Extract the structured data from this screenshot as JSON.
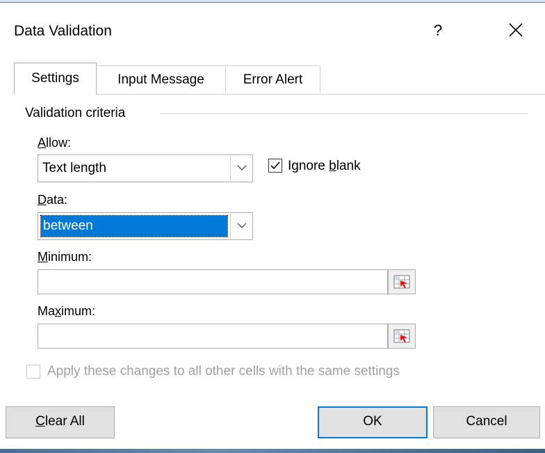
{
  "dialog": {
    "title": "Data Validation",
    "help_label": "?"
  },
  "tabs": [
    {
      "label": "Settings",
      "active": true
    },
    {
      "label": "Input Message",
      "active": false
    },
    {
      "label": "Error Alert",
      "active": false
    }
  ],
  "criteria": {
    "group_label": "Validation criteria",
    "allow": {
      "label_prefix": "",
      "label_mnemonic": "A",
      "label_suffix": "llow:",
      "value": "Text length"
    },
    "ignore_blank": {
      "label_prefix": "Ignore ",
      "label_mnemonic": "b",
      "label_suffix": "lank",
      "checked": true
    },
    "data": {
      "label_prefix": "",
      "label_mnemonic": "D",
      "label_suffix": "ata:",
      "value": "between"
    },
    "minimum": {
      "label_prefix": "",
      "label_mnemonic": "M",
      "label_suffix": "inimum:",
      "value": ""
    },
    "maximum": {
      "label_prefix": "Ma",
      "label_mnemonic": "x",
      "label_suffix": "imum:",
      "value": ""
    }
  },
  "apply_all": {
    "label": "Apply these changes to all other cells with the same settings",
    "checked": false,
    "enabled": false
  },
  "buttons": {
    "clear_all_mnemonic": "C",
    "clear_all_suffix": "lear All",
    "ok": "OK",
    "cancel": "Cancel"
  },
  "colors": {
    "selection": "#0078d7",
    "default_button_border": "#0078d7"
  }
}
